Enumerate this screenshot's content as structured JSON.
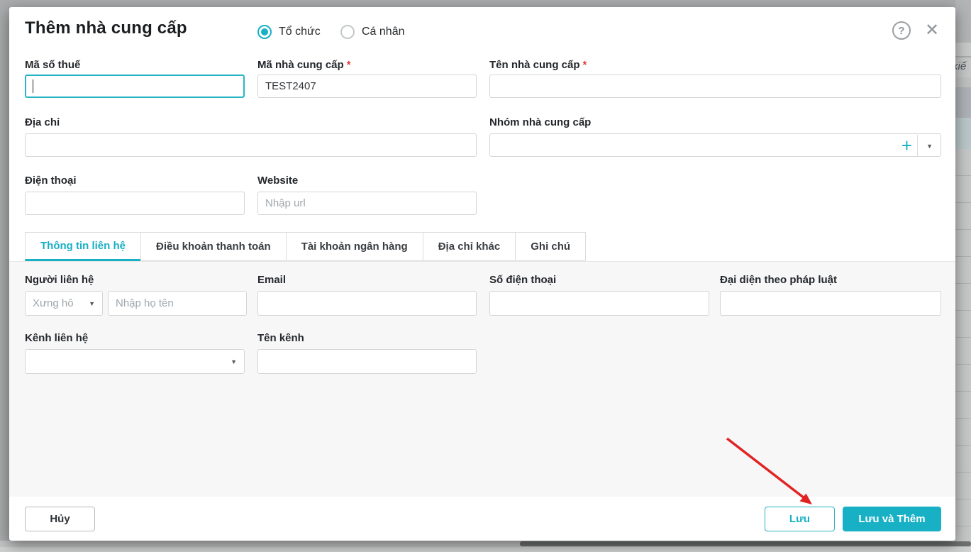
{
  "modal": {
    "title": "Thêm nhà cung cấp",
    "type_options": [
      {
        "label": "Tổ chức",
        "selected": true
      },
      {
        "label": "Cá nhân",
        "selected": false
      }
    ],
    "fields": {
      "tax_code": {
        "label": "Mã số thuế",
        "value": ""
      },
      "supplier_code": {
        "label": "Mã nhà cung cấp",
        "required": "*",
        "value": "TEST2407"
      },
      "supplier_name": {
        "label": "Tên nhà cung cấp",
        "required": "*",
        "value": ""
      },
      "address": {
        "label": "Địa chỉ",
        "value": ""
      },
      "supplier_group": {
        "label": "Nhóm nhà cung cấp",
        "value": ""
      },
      "phone": {
        "label": "Điện thoại",
        "value": ""
      },
      "website": {
        "label": "Website",
        "placeholder": "Nhập url"
      }
    },
    "tabs": [
      {
        "label": "Thông tin liên hệ",
        "active": true
      },
      {
        "label": "Điều khoản thanh toán",
        "active": false
      },
      {
        "label": "Tài khoản ngân hàng",
        "active": false
      },
      {
        "label": "Địa chỉ khác",
        "active": false
      },
      {
        "label": "Ghi chú",
        "active": false
      }
    ],
    "contact_tab": {
      "contact_person": {
        "label": "Người liên hệ",
        "salutation_placeholder": "Xưng hô",
        "name_placeholder": "Nhập họ tên"
      },
      "email": {
        "label": "Email",
        "value": ""
      },
      "phone_number": {
        "label": "Số điện thoại",
        "value": ""
      },
      "legal_representative": {
        "label": "Đại diện theo pháp luật",
        "value": ""
      },
      "contact_channel": {
        "label": "Kênh liên hệ",
        "value": ""
      },
      "channel_name": {
        "label": "Tên kênh",
        "value": ""
      }
    },
    "footer": {
      "cancel": "Hủy",
      "save": "Lưu",
      "save_and_add": "Lưu và Thêm"
    }
  },
  "icons": {
    "help": "?",
    "close": "✕",
    "plus": "+",
    "chevron_down": "▼"
  },
  "background": {
    "partial_text": "kiế"
  },
  "colors": {
    "accent": "#17b0c4",
    "required": "#e53935",
    "arrow": "#e02424",
    "backdrop": "#a9abac"
  }
}
